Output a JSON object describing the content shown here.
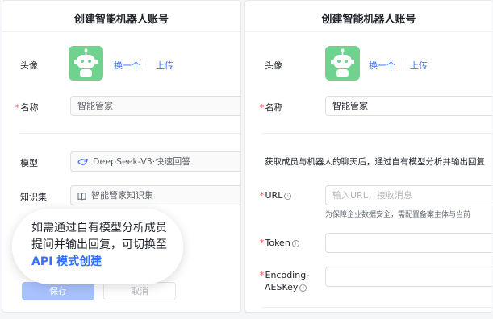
{
  "left": {
    "title": "创建智能机器人账号",
    "avatar_label": "头像",
    "change_link": "换一个",
    "upload_link": "上传",
    "name_label": "名称",
    "name_value": "智能管家",
    "model_label": "模型",
    "model_value": "DeepSeek-V3·快速回答",
    "kb_label": "知识集",
    "kb_value": "智能管家知识集",
    "save_label": "保存",
    "cancel_label": "取消",
    "callout_line1": "如需通过自有模型分析成员",
    "callout_line2": "提问并输出回复，可切换至",
    "callout_link": "API 模式创建"
  },
  "right": {
    "title": "创建智能机器人账号",
    "avatar_label": "头像",
    "change_link": "换一个",
    "upload_link": "上传",
    "name_label": "名称",
    "name_value": "智能管家",
    "description": "获取成员与机器人的聊天后，通过自有模型分析并输出回复",
    "url_label": "URL",
    "url_placeholder": "输入URL，接收消息",
    "url_hint": "为保障企业数据安全，需配置备案主体与当前",
    "token_label": "Token",
    "aeskey_label_1": "Encoding-",
    "aeskey_label_2": "AESKey"
  },
  "colors": {
    "accent": "#3370ff",
    "required": "#f54a45",
    "avatar_bg": "#6fd38f",
    "save_disabled": "#a8c2ff"
  },
  "icons": [
    "robot-avatar-icon",
    "deepseek-whale-icon",
    "book-icon",
    "info-icon"
  ]
}
